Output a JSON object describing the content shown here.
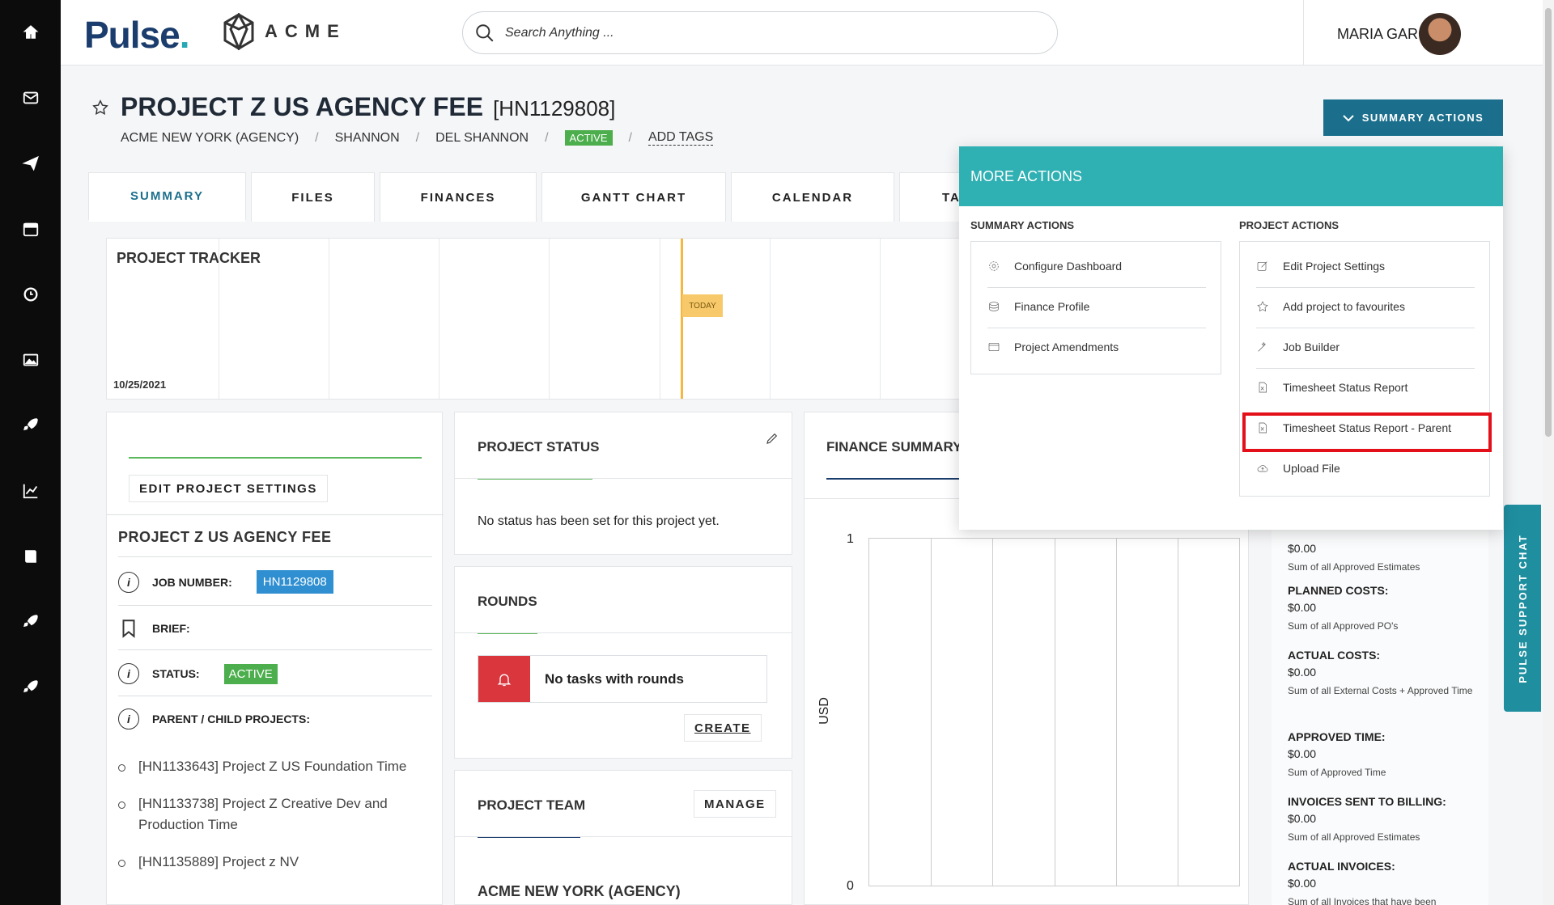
{
  "app": {
    "brand": "Pulse",
    "client_logo": "ACME"
  },
  "search": {
    "placeholder": "Search Anything ..."
  },
  "user": {
    "name": "MARIA GARCIA"
  },
  "sidebar": {
    "items": [
      {
        "icon": "home-icon"
      },
      {
        "icon": "mail-icon"
      },
      {
        "icon": "send-icon"
      },
      {
        "icon": "calendar-icon"
      },
      {
        "icon": "clock-icon"
      },
      {
        "icon": "image-icon"
      },
      {
        "icon": "rocket-icon"
      },
      {
        "icon": "chart-icon"
      },
      {
        "icon": "book-icon"
      },
      {
        "icon": "rocket-icon"
      },
      {
        "icon": "rocket-icon"
      }
    ]
  },
  "project": {
    "title": "PROJECT Z US AGENCY FEE",
    "code": "[HN1129808]",
    "breadcrumb": [
      "ACME NEW YORK (AGENCY)",
      "SHANNON",
      "DEL SHANNON"
    ],
    "status_badge": "ACTIVE",
    "add_tags": "ADD TAGS"
  },
  "summary_actions_label": "SUMMARY ACTIONS",
  "tabs": [
    "SUMMARY",
    "FILES",
    "FINANCES",
    "GANTT CHART",
    "CALENDAR",
    "TA"
  ],
  "tracker": {
    "title": "PROJECT TRACKER",
    "date": "10/25/2021",
    "today": "TODAY"
  },
  "left_panel": {
    "edit_button": "EDIT PROJECT SETTINGS",
    "heading": "PROJECT Z US AGENCY FEE",
    "job_label": "JOB NUMBER:",
    "job_value": "HN1129808",
    "brief_label": "BRIEF:",
    "status_label": "STATUS:",
    "status_value": "ACTIVE",
    "parent_label": "PARENT / CHILD PROJECTS:",
    "children": [
      "[HN1133643] Project Z US Foundation Time",
      "[HN1133738] Project Z Creative Dev and Production Time",
      "[HN1135889] Project z NV"
    ]
  },
  "status_panel": {
    "title": "PROJECT STATUS",
    "message": "No status has been set for this project yet."
  },
  "rounds_panel": {
    "title": "ROUNDS",
    "empty": "No tasks with rounds",
    "create": "CREATE"
  },
  "team_panel": {
    "title": "PROJECT TEAM",
    "manage": "MANAGE",
    "agency": "ACME NEW YORK (AGENCY)"
  },
  "finance": {
    "title": "FINANCE SUMMARY",
    "y_top": "1",
    "y_bottom": "0",
    "y_label": "USD",
    "items": [
      {
        "label": "",
        "value": "$0.00",
        "note": "Sum of all Approved Estimates"
      },
      {
        "label": "PLANNED COSTS:",
        "value": "$0.00",
        "note": "Sum of all Approved PO's"
      },
      {
        "label": "ACTUAL COSTS:",
        "value": "$0.00",
        "note": "Sum of all External Costs + Approved Time"
      },
      {
        "label": "APPROVED TIME:",
        "value": "$0.00",
        "note": "Sum of Approved Time"
      },
      {
        "label": "INVOICES SENT TO BILLING:",
        "value": "$0.00",
        "note": "Sum of all Approved Estimates"
      },
      {
        "label": "ACTUAL INVOICES:",
        "value": "$0.00",
        "note": "Sum of all Invoices that have been"
      }
    ]
  },
  "chart_data": {
    "type": "bar",
    "categories": [],
    "values": [],
    "ylabel": "USD",
    "ylim": [
      0,
      1
    ]
  },
  "support_chat": "PULSE SUPPORT CHAT",
  "dropdown": {
    "title": "MORE ACTIONS",
    "summary_title": "SUMMARY ACTIONS",
    "summary_items": [
      {
        "label": "Configure Dashboard",
        "icon": "gear-icon"
      },
      {
        "label": "Finance Profile",
        "icon": "coins-icon"
      },
      {
        "label": "Project Amendments",
        "icon": "folder-icon"
      }
    ],
    "project_title": "PROJECT ACTIONS",
    "project_items": [
      {
        "label": "Edit Project Settings",
        "icon": "edit-icon"
      },
      {
        "label": "Add project to favourites",
        "icon": "star-icon"
      },
      {
        "label": "Job Builder",
        "icon": "wand-icon"
      },
      {
        "label": "Timesheet Status Report",
        "icon": "excel-icon"
      },
      {
        "label": "Timesheet Status Report - Parent",
        "icon": "excel-icon"
      },
      {
        "label": "Upload File",
        "icon": "cloud-upload-icon"
      }
    ]
  }
}
